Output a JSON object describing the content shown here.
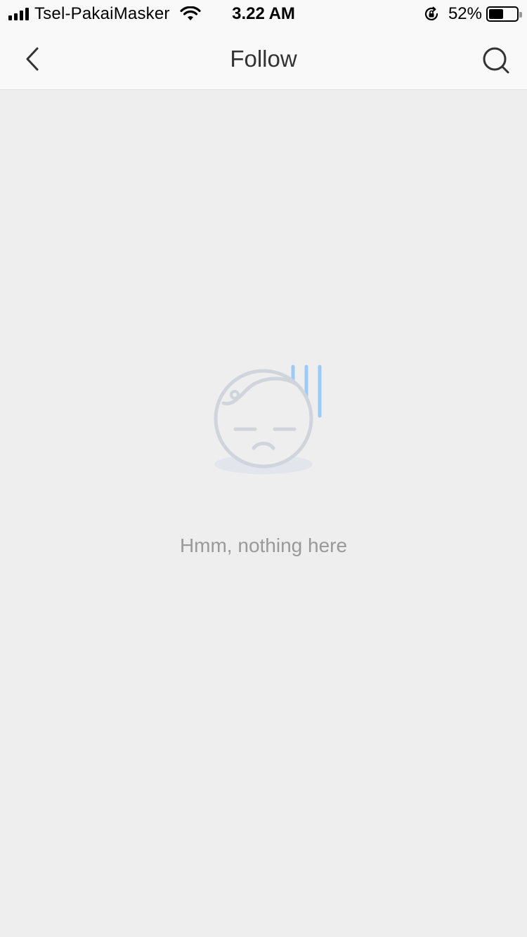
{
  "status_bar": {
    "carrier": "Tsel-PakaiMasker",
    "time": "3.22 AM",
    "battery_percent": "52%",
    "battery_level": 0.52,
    "icons": [
      "signal-icon",
      "wifi-icon",
      "rotation-lock-icon",
      "battery-icon"
    ]
  },
  "nav": {
    "title": "Follow",
    "back_icon": "back-chevron-icon",
    "search_icon": "search-icon"
  },
  "empty_state": {
    "message": "Hmm, nothing here",
    "illustration_icon": "sad-face-icon"
  },
  "colors": {
    "background": "#eeeeee",
    "nav_background": "#f9f9f9",
    "title_text": "#333333",
    "empty_text": "#999999",
    "illustration_stroke": "#d0d4dc",
    "illustration_accent": "#9ccaf7"
  }
}
